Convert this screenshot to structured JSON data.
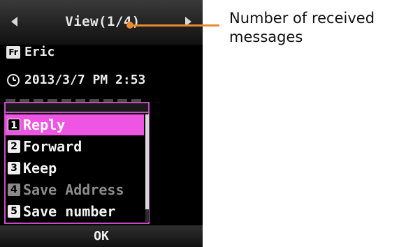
{
  "header": {
    "title": "View(1/4)",
    "left_icon": "arrow-left-icon",
    "right_icon": "arrow-right-icon"
  },
  "message": {
    "sender_badge": "Fr",
    "sender": "Eric",
    "time_icon": "clock-icon",
    "timestamp": "2013/3/7 PM 2:53"
  },
  "menu": {
    "items": [
      {
        "number": "1",
        "label": "Reply",
        "state": "selected"
      },
      {
        "number": "2",
        "label": "Forward",
        "state": "normal"
      },
      {
        "number": "3",
        "label": "Keep",
        "state": "normal"
      },
      {
        "number": "4",
        "label": "Save Address",
        "state": "disabled"
      },
      {
        "number": "5",
        "label": "Save number",
        "state": "normal"
      }
    ]
  },
  "softkey": {
    "label": "OK"
  },
  "callout": {
    "line1": "Number of received",
    "line2": "messages"
  },
  "colors": {
    "accent": "#ef55e3",
    "menu_border": "#c94ac4",
    "callout": "#e98a2f"
  }
}
